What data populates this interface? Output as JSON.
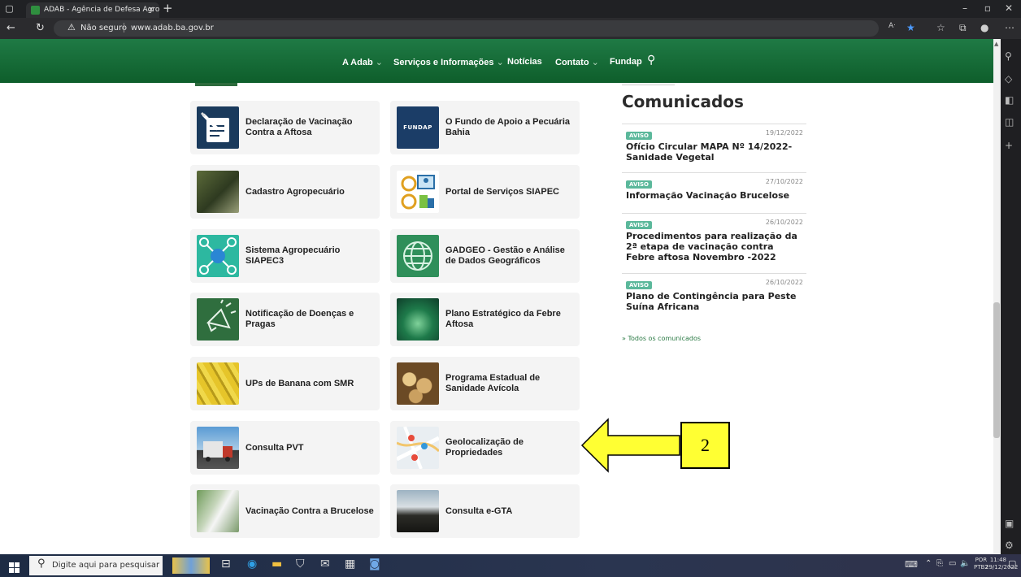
{
  "browser": {
    "tab_title": "ADAB - Agência de Defesa Agrop",
    "security_label": "Não seguro",
    "url": "www.adab.ba.gov.br"
  },
  "nav": {
    "items": [
      "A Adab",
      "Serviços e Informações",
      "Notícias",
      "Contato",
      "Fundap"
    ]
  },
  "services": [
    {
      "label": "Declaração de Vacinação Contra a Aftosa",
      "icon": "vaccination-document-icon"
    },
    {
      "label": "O Fundo de Apoio a Pecuária Bahia",
      "icon": "fundap-logo",
      "icon_text": "FUNDAP"
    },
    {
      "label": "Cadastro Agropecuário",
      "icon": "farm-photo"
    },
    {
      "label": "Portal de Serviços SIAPEC",
      "icon": "gears-icon"
    },
    {
      "label": "Sistema Agropecuário SIAPEC3",
      "icon": "network-icon"
    },
    {
      "label": "GADGEO - Gestão e Análise de Dados Geográficos",
      "icon": "globe-icon"
    },
    {
      "label": "Notificação de Doenças e Pragas",
      "icon": "megaphone-icon"
    },
    {
      "label": "Plano Estratégico da Febre Aftosa",
      "icon": "plan-photo"
    },
    {
      "label": "UPs de Banana com SMR",
      "icon": "banana-photo"
    },
    {
      "label": "Programa Estadual de Sanidade Avícola",
      "icon": "chickens-photo"
    },
    {
      "label": "Consulta PVT",
      "icon": "truck-photo"
    },
    {
      "label": "Geolocalização de Propriedades",
      "icon": "map-photo"
    },
    {
      "label": "Vacinação Contra a Brucelose",
      "icon": "vaccination-photo"
    },
    {
      "label": "Consulta e-GTA",
      "icon": "sunset-photo"
    }
  ],
  "comunicados": {
    "title": "Comunicados",
    "items": [
      {
        "badge": "AVISO",
        "date": "19/12/2022",
        "title": "Ofício Circular MAPA Nº 14/2022- Sanidade Vegetal"
      },
      {
        "badge": "AVISO",
        "date": "27/10/2022",
        "title": "Informação Vacinação Brucelose"
      },
      {
        "badge": "AVISO",
        "date": "26/10/2022",
        "title": "Procedimentos para realização da 2ª etapa de vacinação contra Febre aftosa Novembro -2022"
      },
      {
        "badge": "AVISO",
        "date": "26/10/2022",
        "title": "Plano de Contingência para Peste Suína Africana"
      }
    ],
    "all_link": "» Todos os comunicados"
  },
  "annotation": {
    "number": "2"
  },
  "taskbar": {
    "search_placeholder": "Digite aqui para pesquisar",
    "lang": "POR",
    "layout": "PTB2",
    "time": "11:48",
    "date": "29/12/2022"
  },
  "colors": {
    "nav_green": "#0e5e2b",
    "badge": "#5bb89b",
    "arrow": "#ffff33"
  }
}
